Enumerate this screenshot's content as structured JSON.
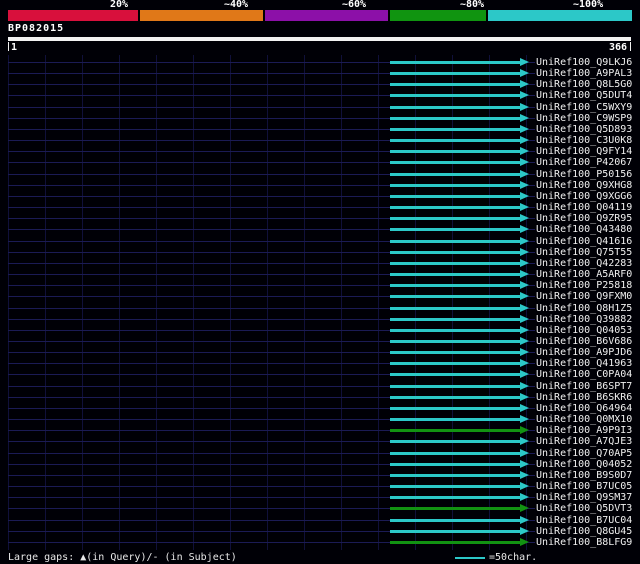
{
  "chart_data": {
    "type": "bar",
    "title": "BP082015",
    "description": "BLAST-style query coverage overview; horizontal rows are database hits aligned to the query, colored by % identity",
    "query": {
      "name": "BP082015",
      "start_label": "1",
      "end_label": "366",
      "length": 366
    },
    "identity_key": {
      "segments": [
        {
          "label": "20%",
          "color": "#d8103c"
        },
        {
          "label": "~40%",
          "color": "#e07818"
        },
        {
          "label": "~60%",
          "color": "#8c10a8"
        },
        {
          "label": "~80%",
          "color": "#109410"
        },
        {
          "label": "~100%",
          "color": "#2cc8c8"
        }
      ]
    },
    "hit_colors": {
      "cyan": "#2cc8c8",
      "green": "#129212"
    },
    "hits_query_span_approx": [
      225,
      305
    ],
    "hits": [
      {
        "label": "UniRef100_Q9LKJ6",
        "tier": "cyan"
      },
      {
        "label": "UniRef100_A9PAL3",
        "tier": "cyan"
      },
      {
        "label": "UniRef100_Q8L5G0",
        "tier": "cyan"
      },
      {
        "label": "UniRef100_Q5DUT4",
        "tier": "cyan"
      },
      {
        "label": "UniRef100_C5WXY9",
        "tier": "cyan"
      },
      {
        "label": "UniRef100_C9WSP9",
        "tier": "cyan"
      },
      {
        "label": "UniRef100_Q5D893",
        "tier": "cyan"
      },
      {
        "label": "UniRef100_C3U0K8",
        "tier": "cyan"
      },
      {
        "label": "UniRef100_Q9FY14",
        "tier": "cyan"
      },
      {
        "label": "UniRef100_P42067",
        "tier": "cyan"
      },
      {
        "label": "UniRef100_P50156",
        "tier": "cyan"
      },
      {
        "label": "UniRef100_Q9XHG8",
        "tier": "cyan"
      },
      {
        "label": "UniRef100_Q9XGG6",
        "tier": "cyan"
      },
      {
        "label": "UniRef100_Q04119",
        "tier": "cyan"
      },
      {
        "label": "UniRef100_Q9ZR95",
        "tier": "cyan"
      },
      {
        "label": "UniRef100_Q43480",
        "tier": "cyan"
      },
      {
        "label": "UniRef100_Q41616",
        "tier": "cyan"
      },
      {
        "label": "UniRef100_Q75T55",
        "tier": "cyan"
      },
      {
        "label": "UniRef100_Q42283",
        "tier": "cyan"
      },
      {
        "label": "UniRef100_A5ARF0",
        "tier": "cyan"
      },
      {
        "label": "UniRef100_P25818",
        "tier": "cyan"
      },
      {
        "label": "UniRef100_Q9FXM0",
        "tier": "cyan"
      },
      {
        "label": "UniRef100_Q8H1Z5",
        "tier": "cyan"
      },
      {
        "label": "UniRef100_Q39882",
        "tier": "cyan"
      },
      {
        "label": "UniRef100_Q04053",
        "tier": "cyan"
      },
      {
        "label": "UniRef100_B6V686",
        "tier": "cyan"
      },
      {
        "label": "UniRef100_A9PJD6",
        "tier": "cyan"
      },
      {
        "label": "UniRef100_Q41963",
        "tier": "cyan"
      },
      {
        "label": "UniRef100_C0PA04",
        "tier": "cyan"
      },
      {
        "label": "UniRef100_B6SPT7",
        "tier": "cyan"
      },
      {
        "label": "UniRef100_B6SKR6",
        "tier": "cyan"
      },
      {
        "label": "UniRef100_Q64964",
        "tier": "cyan"
      },
      {
        "label": "UniRef100_Q0MX10",
        "tier": "cyan"
      },
      {
        "label": "UniRef100_A9P9I3",
        "tier": "green"
      },
      {
        "label": "UniRef100_A7QJE3",
        "tier": "cyan"
      },
      {
        "label": "UniRef100_Q70AP5",
        "tier": "cyan"
      },
      {
        "label": "UniRef100_Q04052",
        "tier": "cyan"
      },
      {
        "label": "UniRef100_B9S0D7",
        "tier": "cyan"
      },
      {
        "label": "UniRef100_B7UC05",
        "tier": "cyan"
      },
      {
        "label": "UniRef100_Q9SM37",
        "tier": "cyan"
      },
      {
        "label": "UniRef100_Q5DVT3",
        "tier": "green"
      },
      {
        "label": "UniRef100_B7UC04",
        "tier": "cyan"
      },
      {
        "label": "UniRef100_Q8GU45",
        "tier": "cyan"
      },
      {
        "label": "UniRef100_B8LFG9",
        "tier": "green"
      }
    ]
  },
  "footer": {
    "gaps_text": "Large gaps: ▲(in Query)/- (in Subject)",
    "scale_label": "=50char."
  }
}
